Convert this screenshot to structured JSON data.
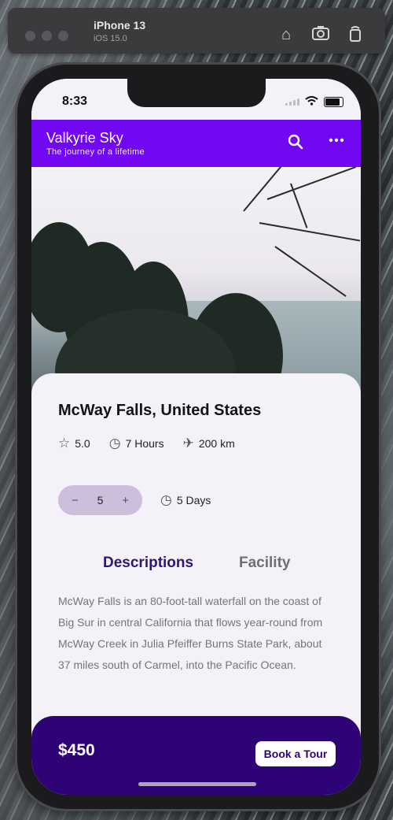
{
  "simulator": {
    "device": "iPhone 13",
    "os": "iOS 15.0",
    "icons": [
      "home-icon",
      "screenshot-icon",
      "rotate-icon"
    ]
  },
  "status_bar": {
    "time": "8:33"
  },
  "app_bar": {
    "title": "Valkyrie Sky",
    "subtitle": "The journey of a lifetime",
    "icons": [
      "search-icon",
      "more-icon"
    ],
    "color": "#7207f1"
  },
  "place": {
    "title": "McWay Falls, United States",
    "rating": "5.0",
    "duration": "7 Hours",
    "distance": "200 km"
  },
  "booking": {
    "quantity": "5",
    "days": "5 Days"
  },
  "tabs": [
    {
      "label": "Descriptions",
      "active": true
    },
    {
      "label": "Facility",
      "active": false
    }
  ],
  "description": "McWay Falls is an 80-foot-tall waterfall on the coast of Big Sur in central California that flows year-round from McWay Creek in Julia Pfeiffer Burns State Park, about 37 miles south of Carmel, into the Pacific Ocean.",
  "footer": {
    "price": "$450",
    "book_label": "Book a Tour",
    "color": "#2e0376"
  }
}
